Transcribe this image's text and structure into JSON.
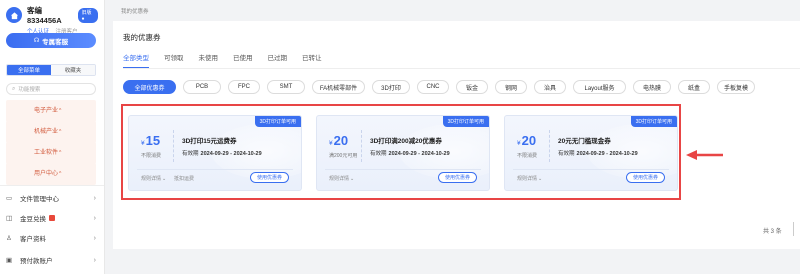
{
  "sidebar": {
    "username": "客编 8334456A",
    "level_badge": "旧版 ●",
    "verify_link": "个人认证",
    "verify_status": "注册客户",
    "service_button": "专属客服",
    "filter_tabs": [
      "全部菜单",
      "收藏夹"
    ],
    "search_placeholder": "功能搜索",
    "categories": [
      "电子产业",
      "机械产业",
      "工业软件",
      "用户中心"
    ],
    "menu_items": [
      {
        "label": "文件管理中心",
        "icon": "folder-icon"
      },
      {
        "label": "金豆兑换",
        "icon": "coin-icon"
      },
      {
        "label": "客户资料",
        "icon": "user-icon"
      },
      {
        "label": "预付款账户",
        "icon": "wallet-icon"
      }
    ]
  },
  "breadcrumb": "我的优惠券",
  "main": {
    "title": "我的优惠券",
    "status_tabs": [
      "全部类型",
      "可领取",
      "未使用",
      "已使用",
      "已过期",
      "已转让"
    ],
    "categories": [
      "全部优惠券",
      "PCB",
      "FPC",
      "SMT",
      "FA机械零部件",
      "3D打印",
      "CNC",
      "钣金",
      "钢网",
      "治具",
      "Layout服务",
      "电热膜",
      "纸盒",
      "手板复模"
    ],
    "coupons": [
      {
        "tag": "3D打印订单可用",
        "currency": "¥",
        "amount": "15",
        "condition": "不限消费",
        "title": "3D打印15元运费券",
        "valid_label": "有效期",
        "valid_range": "2024-09-29 - 2024-10-29",
        "rule": "规则详情",
        "extra": "抵扣运费",
        "use_button": "使用优惠券"
      },
      {
        "tag": "3D打印订单可用",
        "currency": "¥",
        "amount": "20",
        "condition": "满200元可用",
        "title": "3D打印满200减20优惠券",
        "valid_label": "有效期",
        "valid_range": "2024-09-29 - 2024-10-29",
        "rule": "规则详情",
        "extra": "",
        "use_button": "使用优惠券"
      },
      {
        "tag": "3D打印订单可用",
        "currency": "¥",
        "amount": "20",
        "condition": "不限消费",
        "title": "20元无门槛现金券",
        "valid_label": "有效期",
        "valid_range": "2024-09-29 - 2024-10-29",
        "rule": "规则详情",
        "extra": "",
        "use_button": "使用优惠券"
      }
    ],
    "total": "共 3 条"
  },
  "colors": {
    "accent": "#3a6ff0",
    "highlight": "#e84545",
    "category": "#d25a3c"
  }
}
